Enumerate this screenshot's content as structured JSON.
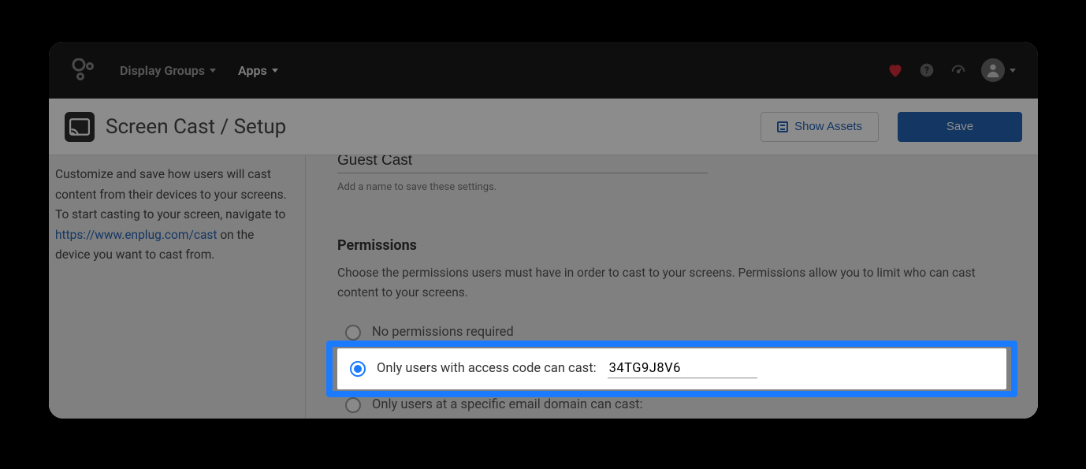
{
  "nav": {
    "display_groups": "Display Groups",
    "apps": "Apps"
  },
  "page": {
    "title": "Screen Cast / Setup",
    "show_assets": "Show Assets",
    "save": "Save"
  },
  "sidebar": {
    "text1": "Customize and save how users will cast content from their devices to your screens. To start casting to your screen, navigate to ",
    "link": "https://www.enplug.com/cast",
    "text2": " on the device you want to cast from."
  },
  "form": {
    "name_value": "Guest Cast",
    "name_helper": "Add a name to save these settings."
  },
  "permissions": {
    "title": "Permissions",
    "desc": "Choose the permissions users must have in order to cast to your screens. Permissions allow you to limit who can cast content to your screens.",
    "options": {
      "none": "No permissions required",
      "access_code": "Only users with access code can cast:",
      "email_domain": "Only users at a specific email domain can cast:"
    },
    "access_code_value": "34TG9J8V6"
  }
}
